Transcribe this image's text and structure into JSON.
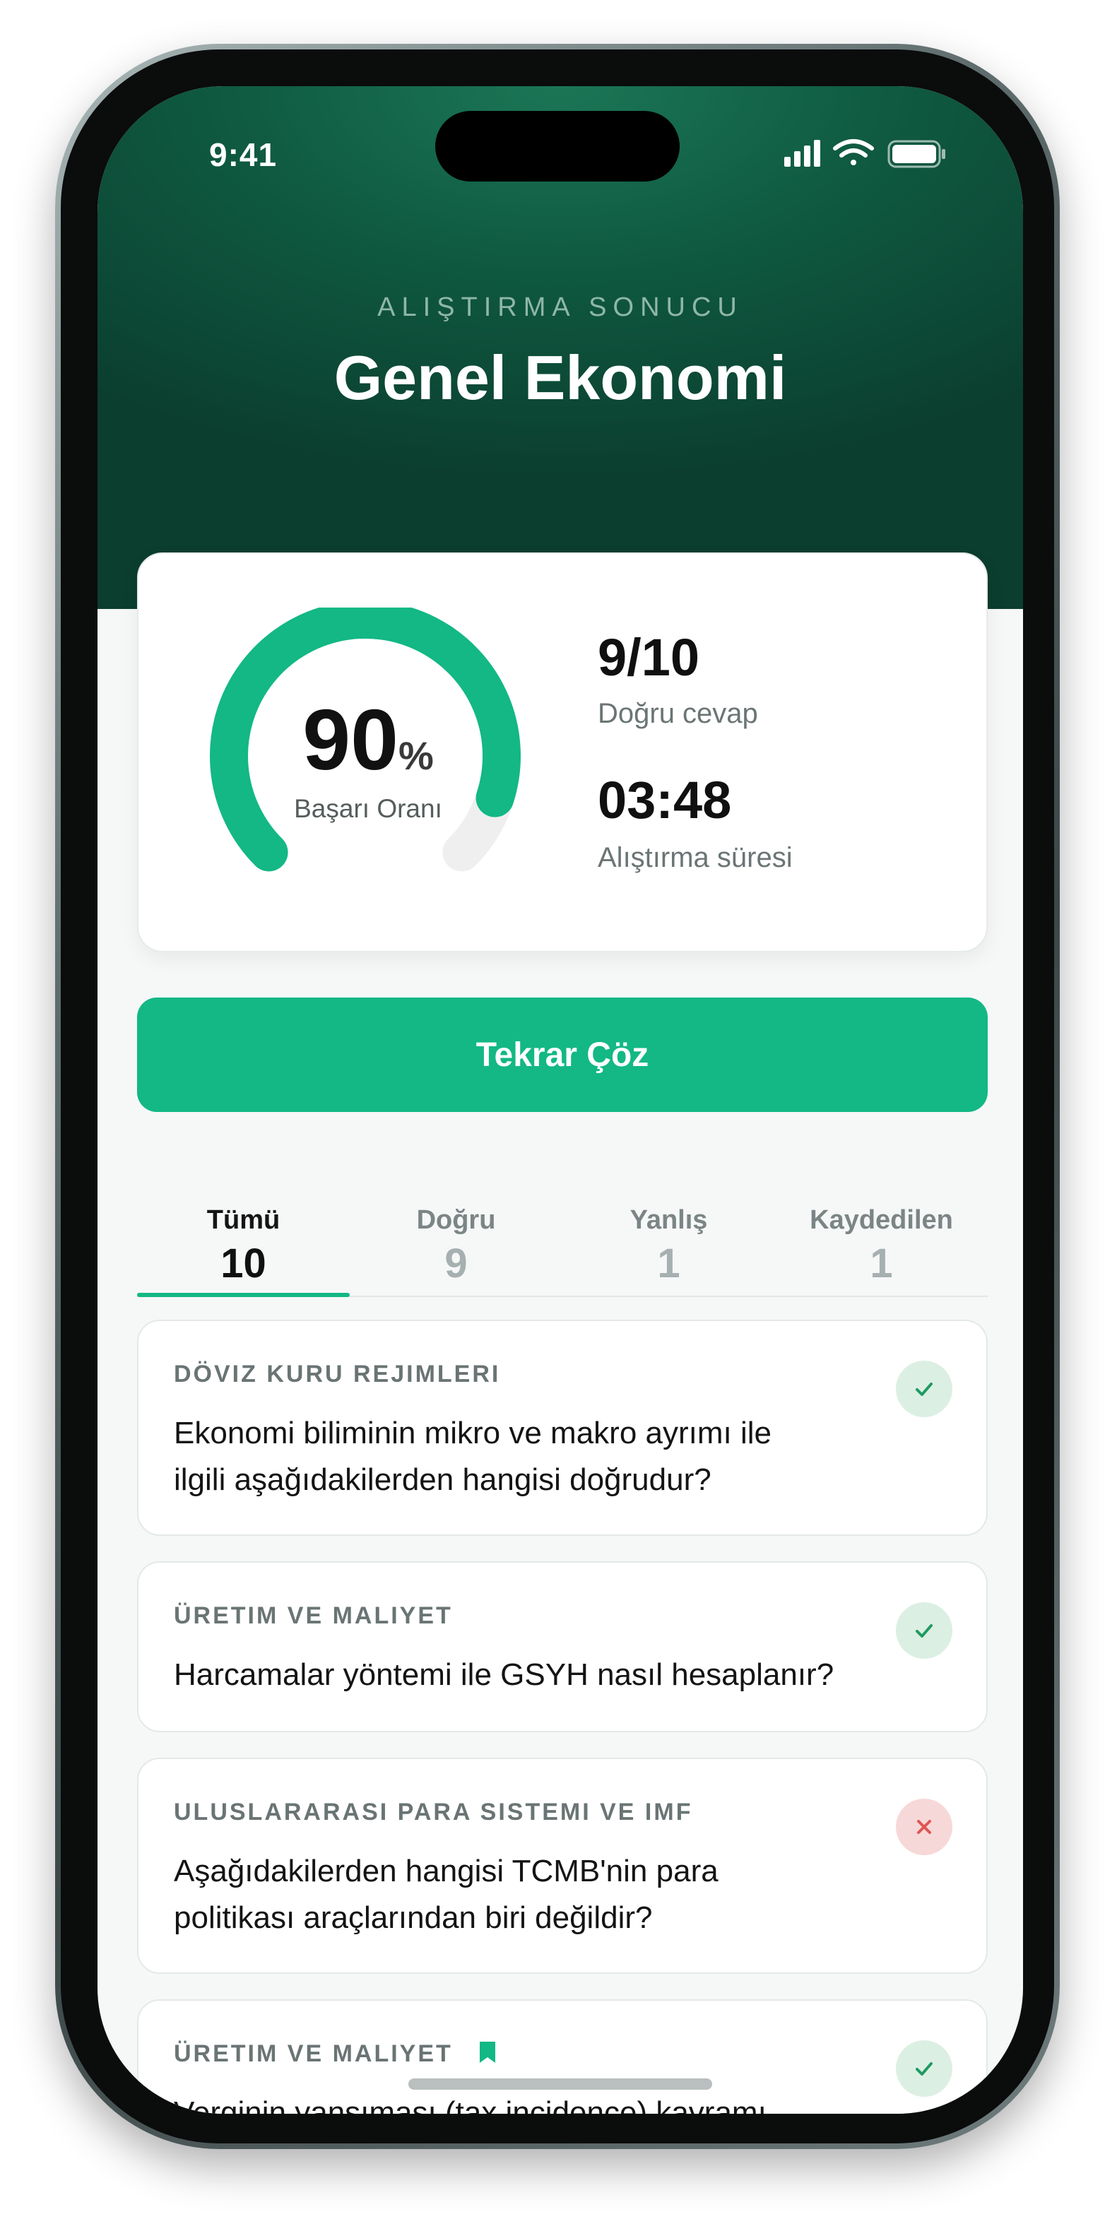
{
  "status": {
    "time": "9:41"
  },
  "header": {
    "eyebrow": "ALIŞTIRMA SONUCU",
    "title": "Genel Ekonomi"
  },
  "score": {
    "percent": "90",
    "percent_sign": "%",
    "percent_label": "Başarı Oranı",
    "gauge_fraction": 0.9,
    "correct_value": "9/10",
    "correct_label": "Doğru cevap",
    "duration_value": "03:48",
    "duration_label": "Alıştırma süresi"
  },
  "retry_button": "Tekrar Çöz",
  "tabs": [
    {
      "label": "Tümü",
      "count": "10"
    },
    {
      "label": "Doğru",
      "count": "9"
    },
    {
      "label": "Yanlış",
      "count": "1"
    },
    {
      "label": "Kaydedilen",
      "count": "1"
    }
  ],
  "questions": [
    {
      "category": "DÖVIZ KURU REJIMLERI",
      "line1": "Ekonomi biliminin mikro ve makro ayrımı ile",
      "line2": "ilgili aşağıdakilerden hangisi doğrudur?",
      "result": "correct"
    },
    {
      "category": "ÜRETIM VE MALIYET",
      "line1": "Harcamalar yöntemi ile GSYH nasıl hesaplanır?",
      "result": "correct"
    },
    {
      "category": "ULUSLARARASI PARA SISTEMI VE IMF",
      "line1": "Aşağıdakilerden hangisi TCMB'nin para",
      "line2": "politikası araçlarından biri değildir?",
      "result": "wrong"
    },
    {
      "category": "ÜRETIM VE MALIYET",
      "line1": "Verginin yansıması (tax incidence) kavramı",
      "result": "correct",
      "bookmarked": true
    }
  ],
  "colors": {
    "accent": "#13b884",
    "hero": "#0f5a41",
    "wrong": "#e05555"
  }
}
